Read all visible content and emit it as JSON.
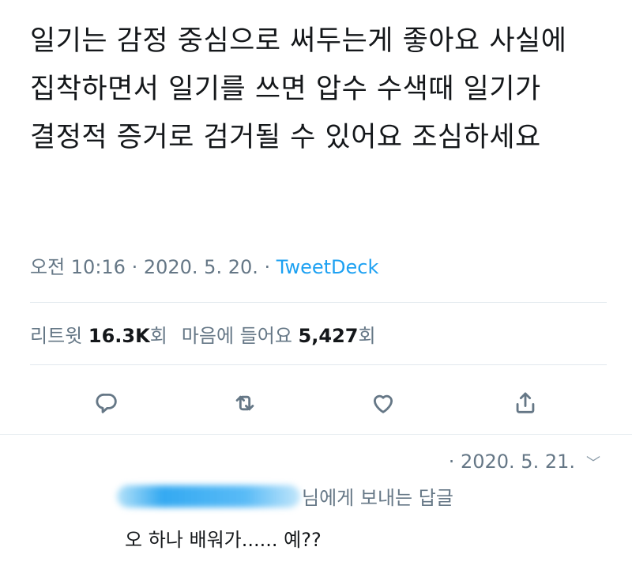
{
  "tweet": {
    "text": "일기는 감정 중심으로 써두는게 좋아요 사실에 집착하면서 일기를 쓰면 압수 수색때 일기가 결정적 증거로 검거될 수 있어요 조심하세요",
    "time": "오전 10:16",
    "date": "2020. 5. 20.",
    "separator": " · ",
    "source": "TweetDeck"
  },
  "stats": {
    "retweets_label": "리트윗",
    "retweets_value": "16.3K",
    "retweets_unit": "회",
    "likes_label": "마음에 들어요",
    "likes_value": "5,427",
    "likes_unit": "회"
  },
  "actions": {
    "reply_icon": "reply-icon",
    "retweet_icon": "retweet-icon",
    "like_icon": "heart-icon",
    "share_icon": "share-icon"
  },
  "reply": {
    "date": "· 2020. 5. 21.",
    "chevron": "﹀",
    "reply_to_suffix": "님에게 보내는 답글",
    "text": "오 하나 배워가...... 예??"
  },
  "colors": {
    "text": "#14171a",
    "secondary": "#657786",
    "accent": "#1da1f2",
    "divider": "#e1e8ed"
  }
}
